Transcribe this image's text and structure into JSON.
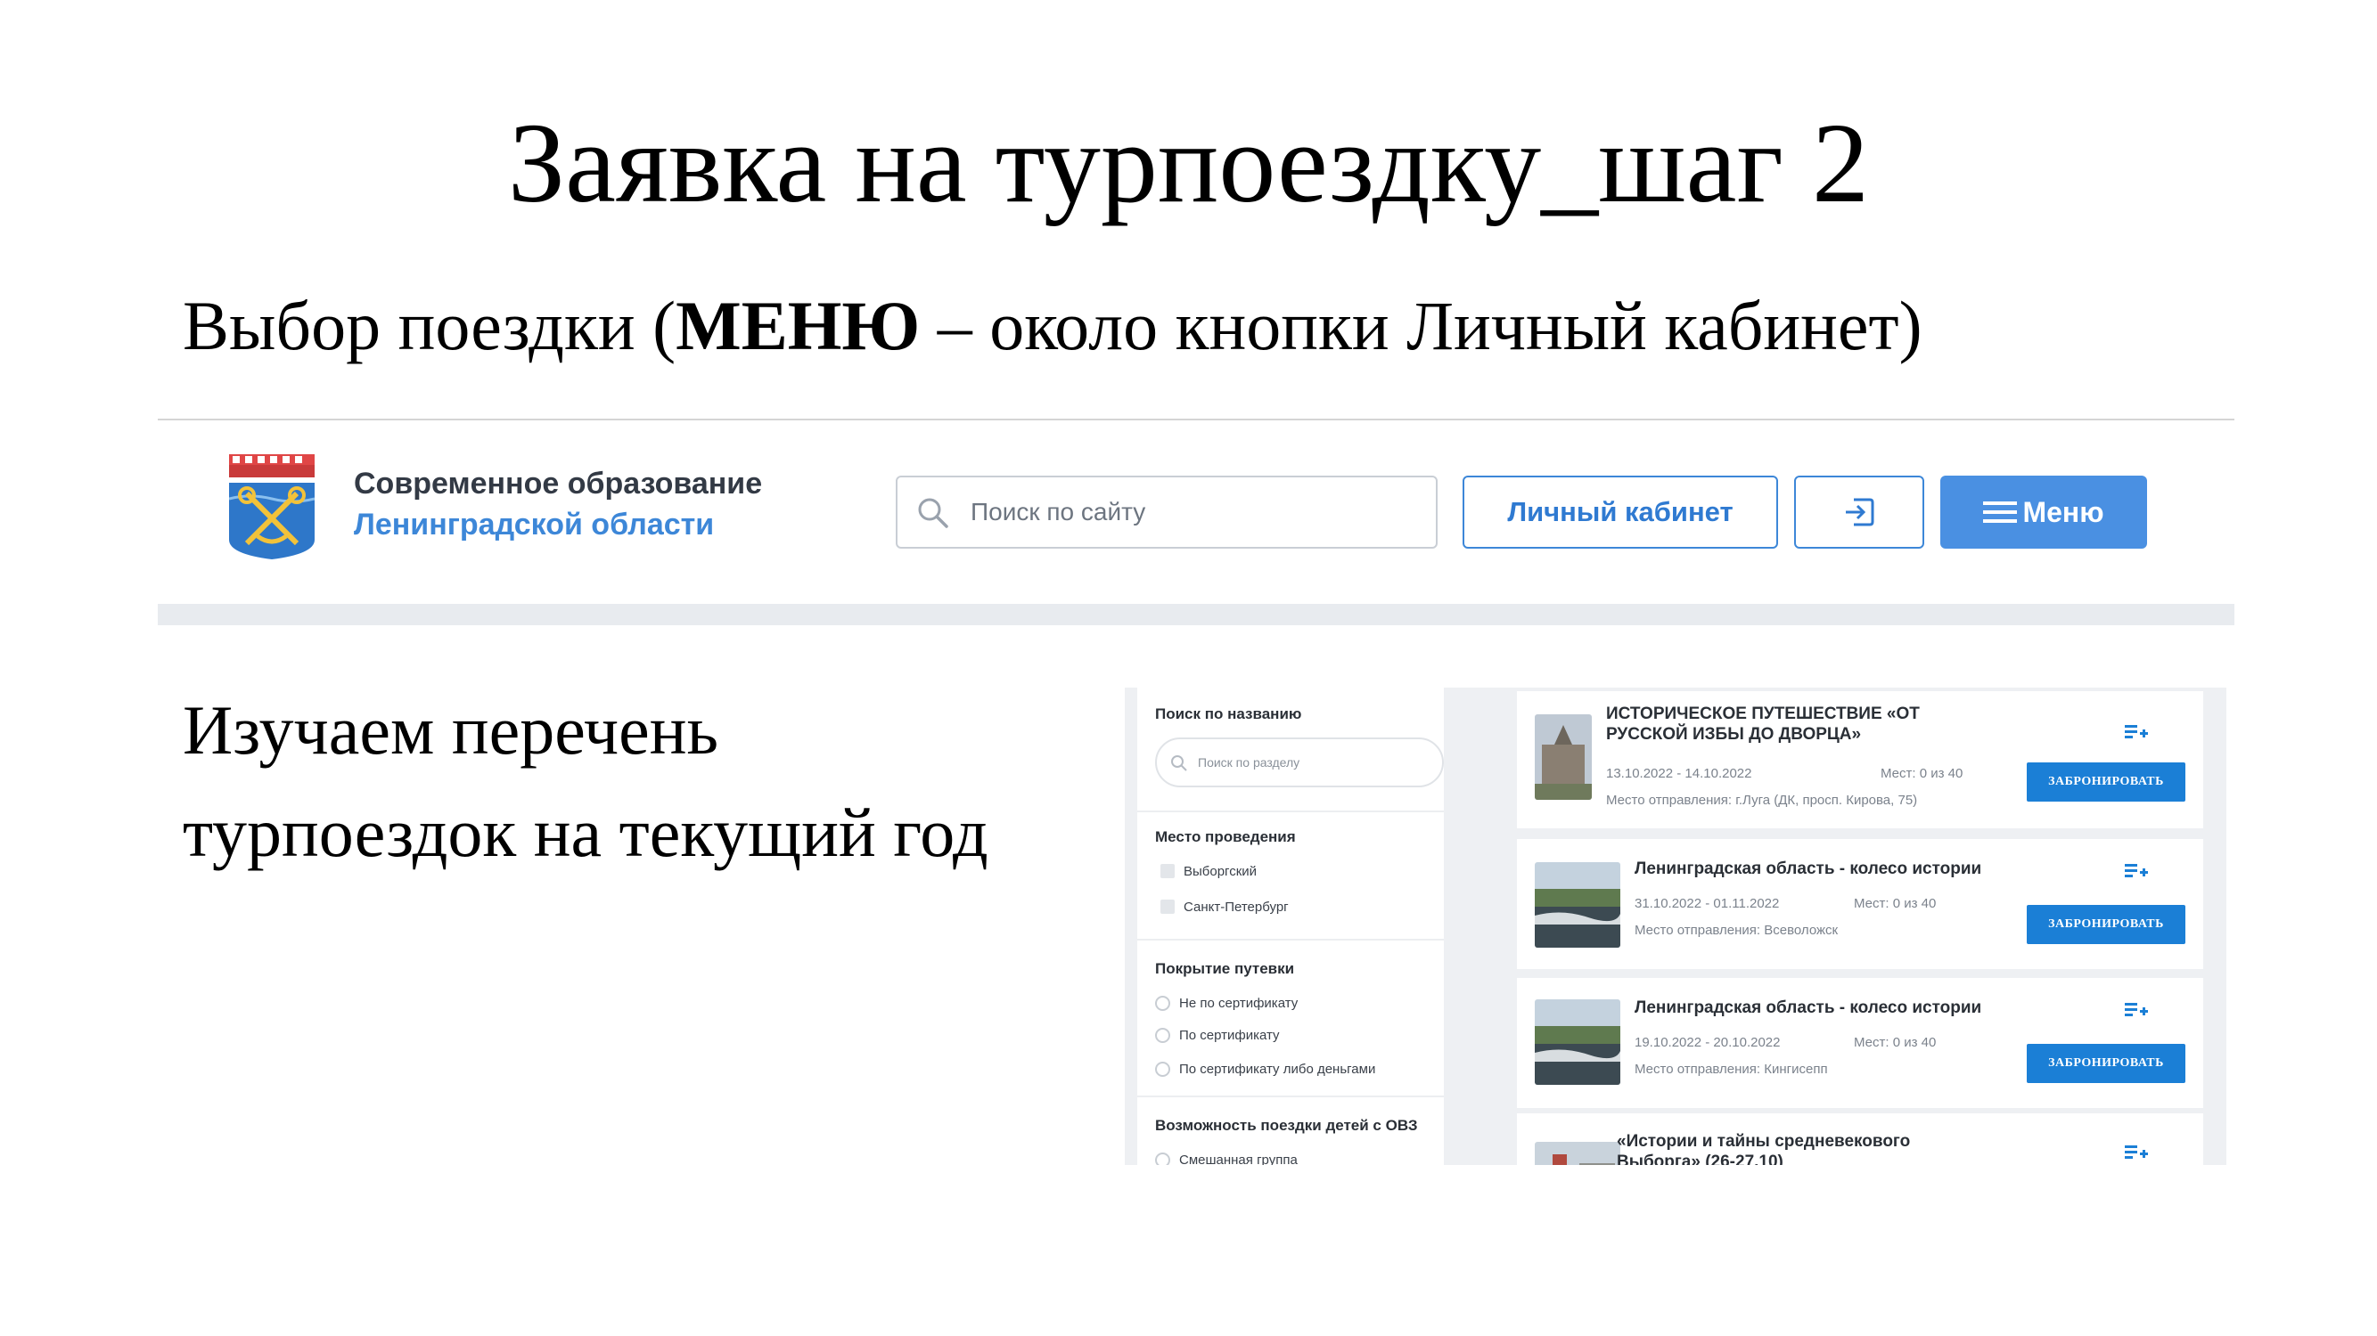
{
  "slide": {
    "title": "Заявка на турпоездку_шаг 2",
    "subtitle_prefix": "Выбор поездки (",
    "subtitle_bold": "МЕНЮ",
    "subtitle_suffix": " – около кнопки Личный кабинет)",
    "body_line1": "Изучаем перечень",
    "body_line2": "турпоездок на текущий год"
  },
  "header": {
    "org_line1": "Современное образование",
    "org_line2": "Ленинградской области",
    "search_placeholder": "Поиск по сайту",
    "cabinet_label": "Личный кабинет",
    "menu_label": "Меню",
    "colors": {
      "accent": "#4a90e2",
      "link": "#3d87d8",
      "band": "#e8ebef"
    }
  },
  "filters": {
    "search_label": "Поиск по названию",
    "search_placeholder": "Поиск по разделу",
    "venue_label": "Место проведения",
    "venue_options": [
      "Выборгский",
      "Санкт-Петербург"
    ],
    "coverage_label": "Покрытие путевки",
    "coverage_options": [
      "Не по сертификату",
      "По сертификату",
      "По сертификату либо деньгами"
    ],
    "ovz_label": "Возможность поездки детей с ОВЗ",
    "ovz_options": [
      "Смешанная группа"
    ]
  },
  "trips": [
    {
      "title": "ИСТОРИЧЕСКОЕ ПУТЕШЕСТВИЕ «ОТ РУССКОЙ ИЗБЫ ДО ДВОРЦА»",
      "dates": "13.10.2022 - 14.10.2022",
      "seats": "Мест: 0 из 40",
      "place": "Место отправления: г.Луга (ДК, просп. Кирова, 75)",
      "book_label": "ЗАБРОНИРОВАТЬ"
    },
    {
      "title": "Ленинградская область - колесо истории",
      "dates": "31.10.2022 - 01.11.2022",
      "seats": "Мест: 0 из 40",
      "place": "Место отправления: Всеволожск",
      "book_label": "ЗАБРОНИРОВАТЬ"
    },
    {
      "title": "Ленинградская область - колесо истории",
      "dates": "19.10.2022 - 20.10.2022",
      "seats": "Мест: 0 из 40",
      "place": "Место отправления: Кингисепп",
      "book_label": "ЗАБРОНИРОВАТЬ"
    },
    {
      "title": "«Истории и тайны средневекового Выборга» (26-27.10)"
    }
  ]
}
